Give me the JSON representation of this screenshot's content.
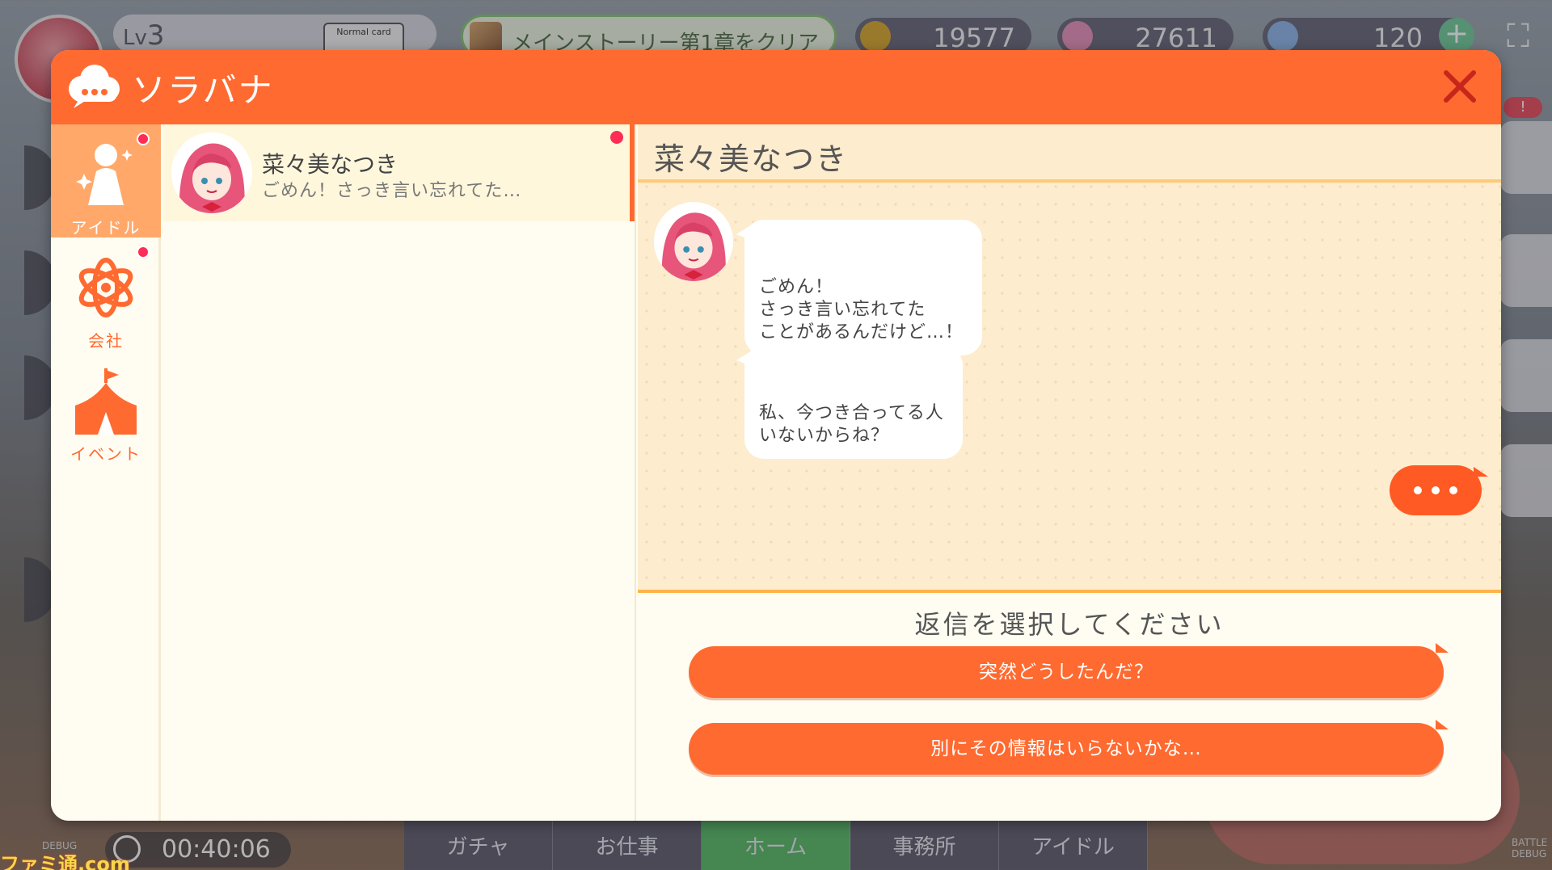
{
  "background": {
    "level": {
      "prefix": "Lv",
      "value": "3"
    },
    "normal_card": "Normal card",
    "mission": "メインストーリー第1章をクリア",
    "currencies": [
      {
        "icon": "gold-coin-icon",
        "value": "19577",
        "color": "#d6a72b"
      },
      {
        "icon": "pink-gem-icon",
        "value": "27611",
        "color": "#e58fb7"
      },
      {
        "icon": "rainbow-gem-icon",
        "value": "120",
        "color": "#8ab4e8"
      }
    ],
    "clock": "00:40:06",
    "nav": [
      "ガチャ",
      "お仕事",
      "ホーム",
      "事務所",
      "アイドル"
    ],
    "debug_left": "DEBUG",
    "debug_right": [
      "BATTLE",
      "DEBUG"
    ],
    "watermark": "ファミ通.com"
  },
  "modal": {
    "title": "ソラバナ",
    "colors": {
      "header": "#ff6a30",
      "accent": "#ff6a30",
      "unread": "#ff2c55"
    },
    "rail": [
      {
        "label": "アイドル",
        "icon": "idol-icon",
        "active": true,
        "unread": true
      },
      {
        "label": "会社",
        "icon": "company-icon",
        "active": false,
        "unread": true
      },
      {
        "label": "イベント",
        "icon": "event-tent-icon",
        "active": false,
        "unread": false
      }
    ],
    "help": "?",
    "conversations": [
      {
        "name": "菜々美なつき",
        "preview": "ごめん！さっき言い忘れてた…",
        "unread": true
      }
    ],
    "chat": {
      "partner": "菜々美なつき",
      "messages": [
        {
          "from": "partner",
          "text": "ごめん！\nさっき言い忘れてた\nことがあるんだけど…！"
        },
        {
          "from": "partner",
          "text": "私、今つき合ってる人\nいないからね？"
        }
      ],
      "typing": true
    },
    "reply": {
      "prompt": "返信を選択してください",
      "options": [
        "突然どうしたんだ？",
        "別にその情報はいらないかな…"
      ]
    }
  }
}
